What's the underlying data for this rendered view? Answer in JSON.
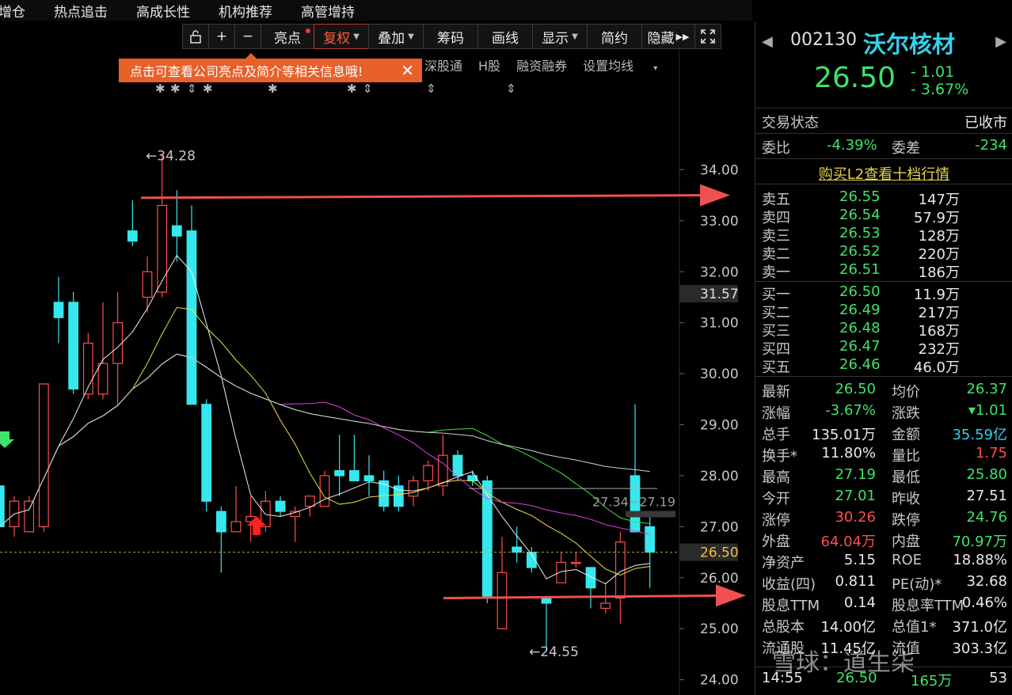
{
  "topnav": [
    "增仓",
    "热点追击",
    "高成长性",
    "机构推荐",
    "高管增持"
  ],
  "toolbar": {
    "lock_icon": "lock-open-icon",
    "plus": "+",
    "minus": "−",
    "liangdian": "亮点",
    "fuquan": "复权",
    "diejia": "叠加",
    "chouma": "筹码",
    "huaxian": "画线",
    "xianshi": "显示",
    "jianyue": "简约",
    "yincang": "隐藏",
    "fullscreen_icon": "fullscreen-icon"
  },
  "subnav": [
    "深股通",
    "H股",
    "融资融券",
    "设置均线"
  ],
  "tooltip": {
    "text": "点击可查看公司亮点及简介等相关信息哦!",
    "close": "✕"
  },
  "colors": {
    "up": "#ff4d4d",
    "down": "#35e8ee",
    "green": "#3ee36a",
    "accent": "#e8602a"
  },
  "chart_data": {
    "type": "candlestick",
    "ylim": [
      23.7,
      35.0
    ],
    "yticks": [
      24.0,
      25.0,
      26.0,
      27.0,
      28.0,
      29.0,
      30.0,
      31.0,
      32.0,
      33.0,
      34.0
    ],
    "ytick_labels": [
      "24.00",
      "25.00",
      "26.00",
      "27.00",
      "28.00",
      "29.00",
      "30.00",
      "31.00",
      "32.00",
      "33.00",
      "34.00"
    ],
    "current_label": "26.50",
    "hover_label": "31.57",
    "max_annotation": "34.28",
    "min_annotation": "24.55",
    "resistance_annotation": "27.34~27.19",
    "candles": [
      {
        "o": 27.8,
        "h": 28.0,
        "l": 26.9,
        "c": 27.0
      },
      {
        "o": 27.0,
        "h": 27.6,
        "l": 26.8,
        "c": 27.5
      },
      {
        "o": 26.9,
        "h": 27.6,
        "l": 26.9,
        "c": 27.5
      },
      {
        "o": 27.0,
        "h": 29.8,
        "l": 26.9,
        "c": 29.8
      },
      {
        "o": 31.4,
        "h": 31.9,
        "l": 30.6,
        "c": 31.1
      },
      {
        "o": 31.4,
        "h": 31.6,
        "l": 29.6,
        "c": 29.7
      },
      {
        "o": 29.6,
        "h": 30.8,
        "l": 29.5,
        "c": 30.6
      },
      {
        "o": 29.6,
        "h": 31.4,
        "l": 29.5,
        "c": 30.2
      },
      {
        "o": 30.2,
        "h": 31.6,
        "l": 29.4,
        "c": 31.0
      },
      {
        "o": 32.8,
        "h": 33.4,
        "l": 32.5,
        "c": 32.6
      },
      {
        "o": 31.5,
        "h": 32.3,
        "l": 31.2,
        "c": 32.0
      },
      {
        "o": 31.6,
        "h": 34.3,
        "l": 31.5,
        "c": 33.3
      },
      {
        "o": 32.9,
        "h": 33.6,
        "l": 32.2,
        "c": 32.7
      },
      {
        "o": 32.8,
        "h": 33.3,
        "l": 29.4,
        "c": 29.4
      },
      {
        "o": 29.4,
        "h": 29.5,
        "l": 27.3,
        "c": 27.5
      },
      {
        "o": 27.3,
        "h": 27.4,
        "l": 26.1,
        "c": 26.9
      },
      {
        "o": 26.9,
        "h": 27.8,
        "l": 26.9,
        "c": 27.1
      },
      {
        "o": 27.1,
        "h": 27.6,
        "l": 26.7,
        "c": 27.2
      },
      {
        "o": 27.0,
        "h": 27.7,
        "l": 26.9,
        "c": 27.5
      },
      {
        "o": 27.5,
        "h": 27.6,
        "l": 27.2,
        "c": 27.3
      },
      {
        "o": 27.2,
        "h": 27.4,
        "l": 26.7,
        "c": 27.3
      },
      {
        "o": 27.4,
        "h": 27.6,
        "l": 27.2,
        "c": 27.6
      },
      {
        "o": 27.4,
        "h": 28.1,
        "l": 27.4,
        "c": 28.0
      },
      {
        "o": 28.1,
        "h": 28.8,
        "l": 27.6,
        "c": 28.0
      },
      {
        "o": 28.1,
        "h": 28.8,
        "l": 27.9,
        "c": 27.9
      },
      {
        "o": 28.0,
        "h": 28.4,
        "l": 27.6,
        "c": 27.9
      },
      {
        "o": 27.9,
        "h": 28.1,
        "l": 27.3,
        "c": 27.4
      },
      {
        "o": 27.8,
        "h": 28.0,
        "l": 27.3,
        "c": 27.4
      },
      {
        "o": 27.6,
        "h": 28.0,
        "l": 27.4,
        "c": 27.9
      },
      {
        "o": 27.9,
        "h": 28.3,
        "l": 27.7,
        "c": 28.2
      },
      {
        "o": 27.8,
        "h": 28.8,
        "l": 27.6,
        "c": 28.4
      },
      {
        "o": 28.4,
        "h": 28.5,
        "l": 27.9,
        "c": 28.0
      },
      {
        "o": 28.0,
        "h": 28.1,
        "l": 27.8,
        "c": 27.9
      },
      {
        "o": 27.9,
        "h": 28.0,
        "l": 25.5,
        "c": 25.6
      },
      {
        "o": 25.0,
        "h": 26.8,
        "l": 25.0,
        "c": 26.1
      },
      {
        "o": 26.6,
        "h": 27.0,
        "l": 26.3,
        "c": 26.5
      },
      {
        "o": 26.5,
        "h": 26.6,
        "l": 26.1,
        "c": 26.2
      },
      {
        "o": 25.6,
        "h": 25.6,
        "l": 24.55,
        "c": 25.5
      },
      {
        "o": 25.9,
        "h": 26.5,
        "l": 25.9,
        "c": 26.3
      },
      {
        "o": 26.3,
        "h": 26.5,
        "l": 26.2,
        "c": 26.3
      },
      {
        "o": 26.2,
        "h": 26.2,
        "l": 25.4,
        "c": 25.8
      },
      {
        "o": 25.4,
        "h": 25.9,
        "l": 25.3,
        "c": 25.5
      },
      {
        "o": 25.6,
        "h": 26.9,
        "l": 25.1,
        "c": 26.7
      },
      {
        "o": 28.0,
        "h": 29.4,
        "l": 27.4,
        "c": 26.9
      },
      {
        "o": 27.0,
        "h": 27.2,
        "l": 25.8,
        "c": 26.5
      }
    ]
  },
  "panel": {
    "code": "002130",
    "name": "沃尔核材",
    "price": "26.50",
    "change": "- 1.01",
    "change_pct": "- 3.67%",
    "status_label": "交易状态",
    "status_value": "已收市",
    "weibi_label": "委比",
    "weibi_value": "-4.39%",
    "weicha_label": "委差",
    "weicha_value": "-234",
    "buy_l2": "购买L2查看十档行情",
    "asks": [
      {
        "label": "卖五",
        "price": "26.55",
        "vol": "147万"
      },
      {
        "label": "卖四",
        "price": "26.54",
        "vol": "57.9万"
      },
      {
        "label": "卖三",
        "price": "26.53",
        "vol": "128万"
      },
      {
        "label": "卖二",
        "price": "26.52",
        "vol": "220万"
      },
      {
        "label": "卖一",
        "price": "26.51",
        "vol": "186万"
      }
    ],
    "bids": [
      {
        "label": "买一",
        "price": "26.50",
        "vol": "11.9万"
      },
      {
        "label": "买二",
        "price": "26.49",
        "vol": "217万"
      },
      {
        "label": "买三",
        "price": "26.48",
        "vol": "168万"
      },
      {
        "label": "买四",
        "price": "26.47",
        "vol": "232万"
      },
      {
        "label": "买五",
        "price": "26.46",
        "vol": "46.0万"
      }
    ],
    "stats": [
      {
        "l1": "最新",
        "v1": "26.50",
        "c1": "g",
        "l2": "均价",
        "v2": "26.37",
        "c2": "g"
      },
      {
        "l1": "涨幅",
        "v1": "-3.67%",
        "c1": "g",
        "l2": "涨跌",
        "v2": "▾1.01",
        "c2": "g"
      },
      {
        "l1": "总手",
        "v1": "135.01万",
        "c1": "w",
        "l2": "金额",
        "v2": "35.59亿",
        "c2": "c"
      },
      {
        "l1": "换手*",
        "v1": "11.80%",
        "c1": "w",
        "l2": "量比",
        "v2": "1.75",
        "c2": "r"
      },
      {
        "l1": "最高",
        "v1": "27.19",
        "c1": "g",
        "l2": "最低",
        "v2": "25.80",
        "c2": "g"
      },
      {
        "l1": "今开",
        "v1": "27.01",
        "c1": "g",
        "l2": "昨收",
        "v2": "27.51",
        "c2": "w"
      },
      {
        "l1": "涨停",
        "v1": "30.26",
        "c1": "r",
        "l2": "跌停",
        "v2": "24.76",
        "c2": "g"
      },
      {
        "l1": "外盘",
        "v1": "64.04万",
        "c1": "r",
        "l2": "内盘",
        "v2": "70.97万",
        "c2": "g"
      },
      {
        "l1": "净资产",
        "v1": "5.15",
        "c1": "w",
        "l2": "ROE",
        "v2": "18.88%",
        "c2": "w"
      },
      {
        "l1": "收益(四)",
        "v1": "0.811",
        "c1": "w",
        "l2": "PE(动)*",
        "v2": "32.68",
        "c2": "w"
      },
      {
        "l1": "股息TTM",
        "v1": "0.14",
        "c1": "w",
        "l2": "股息率TTM",
        "v2": "0.46%",
        "c2": "w"
      },
      {
        "l1": "总股本",
        "v1": "14.00亿",
        "c1": "w",
        "l2": "总值1*",
        "v2": "371.0亿",
        "c2": "w"
      },
      {
        "l1": "流通股",
        "v1": "11.45亿",
        "c1": "w",
        "l2": "流值",
        "v2": "303.3亿",
        "c2": "w"
      }
    ],
    "tick": {
      "time": "14:55",
      "price": "26.50",
      "vol": "165万",
      "num": "53"
    }
  },
  "watermark": "雪球：道生柒"
}
